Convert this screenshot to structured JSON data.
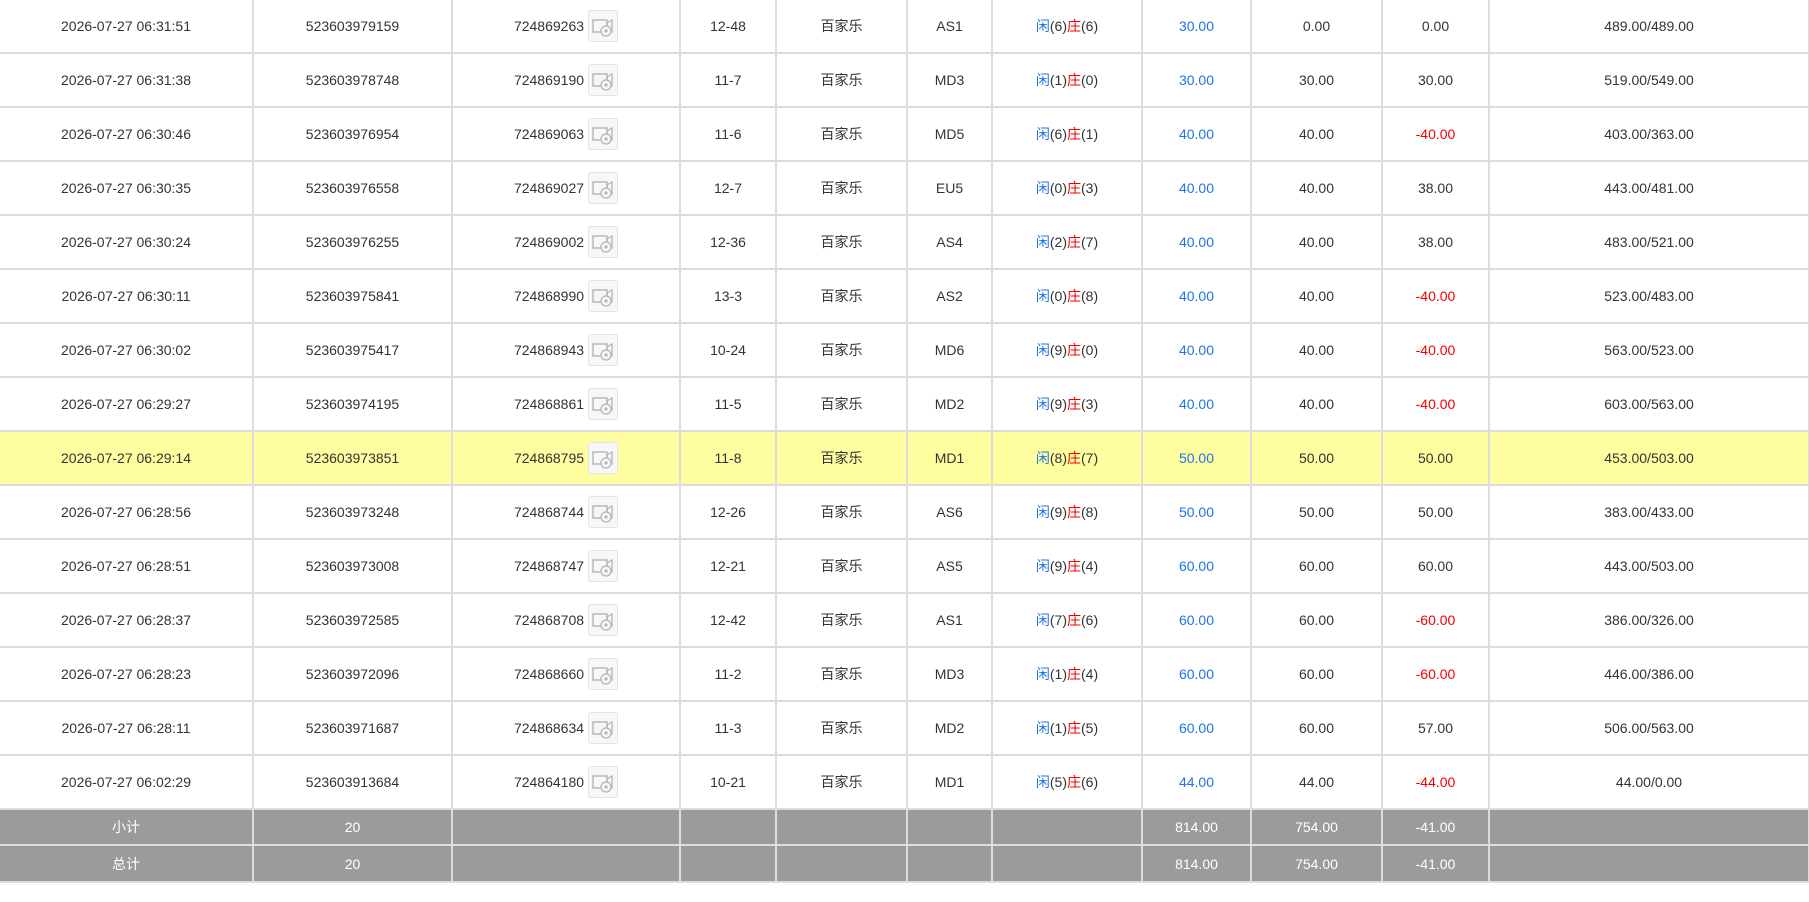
{
  "colors": {
    "player": "#1e73e8",
    "banker": "#f00000",
    "bet_amount": "#1e73e8",
    "negative": "#f00000",
    "highlight_row": "#fefea0",
    "summary_bg": "#9b9b9b"
  },
  "rows": [
    {
      "time": "2026-07-27 06:31:51",
      "order_no": "523603979159",
      "game_no": "724869263",
      "table_round": "12-48",
      "game_type": "百家乐",
      "table": "AS1",
      "player_label": "闲",
      "player_points": "(6)",
      "banker_label": "庄",
      "banker_points": "(6)",
      "bet": "30.00",
      "valid_bet": "0.00",
      "win_loss": "0.00",
      "win_loss_negative": false,
      "balance": "489.00/489.00",
      "highlight": false
    },
    {
      "time": "2026-07-27 06:31:38",
      "order_no": "523603978748",
      "game_no": "724869190",
      "table_round": "11-7",
      "game_type": "百家乐",
      "table": "MD3",
      "player_label": "闲",
      "player_points": "(1)",
      "banker_label": "庄",
      "banker_points": "(0)",
      "bet": "30.00",
      "valid_bet": "30.00",
      "win_loss": "30.00",
      "win_loss_negative": false,
      "balance": "519.00/549.00",
      "highlight": false
    },
    {
      "time": "2026-07-27 06:30:46",
      "order_no": "523603976954",
      "game_no": "724869063",
      "table_round": "11-6",
      "game_type": "百家乐",
      "table": "MD5",
      "player_label": "闲",
      "player_points": "(6)",
      "banker_label": "庄",
      "banker_points": "(1)",
      "bet": "40.00",
      "valid_bet": "40.00",
      "win_loss": "-40.00",
      "win_loss_negative": true,
      "balance": "403.00/363.00",
      "highlight": false
    },
    {
      "time": "2026-07-27 06:30:35",
      "order_no": "523603976558",
      "game_no": "724869027",
      "table_round": "12-7",
      "game_type": "百家乐",
      "table": "EU5",
      "player_label": "闲",
      "player_points": "(0)",
      "banker_label": "庄",
      "banker_points": "(3)",
      "bet": "40.00",
      "valid_bet": "40.00",
      "win_loss": "38.00",
      "win_loss_negative": false,
      "balance": "443.00/481.00",
      "highlight": false
    },
    {
      "time": "2026-07-27 06:30:24",
      "order_no": "523603976255",
      "game_no": "724869002",
      "table_round": "12-36",
      "game_type": "百家乐",
      "table": "AS4",
      "player_label": "闲",
      "player_points": "(2)",
      "banker_label": "庄",
      "banker_points": "(7)",
      "bet": "40.00",
      "valid_bet": "40.00",
      "win_loss": "38.00",
      "win_loss_negative": false,
      "balance": "483.00/521.00",
      "highlight": false
    },
    {
      "time": "2026-07-27 06:30:11",
      "order_no": "523603975841",
      "game_no": "724868990",
      "table_round": "13-3",
      "game_type": "百家乐",
      "table": "AS2",
      "player_label": "闲",
      "player_points": "(0)",
      "banker_label": "庄",
      "banker_points": "(8)",
      "bet": "40.00",
      "valid_bet": "40.00",
      "win_loss": "-40.00",
      "win_loss_negative": true,
      "balance": "523.00/483.00",
      "highlight": false
    },
    {
      "time": "2026-07-27 06:30:02",
      "order_no": "523603975417",
      "game_no": "724868943",
      "table_round": "10-24",
      "game_type": "百家乐",
      "table": "MD6",
      "player_label": "闲",
      "player_points": "(9)",
      "banker_label": "庄",
      "banker_points": "(0)",
      "bet": "40.00",
      "valid_bet": "40.00",
      "win_loss": "-40.00",
      "win_loss_negative": true,
      "balance": "563.00/523.00",
      "highlight": false
    },
    {
      "time": "2026-07-27 06:29:27",
      "order_no": "523603974195",
      "game_no": "724868861",
      "table_round": "11-5",
      "game_type": "百家乐",
      "table": "MD2",
      "player_label": "闲",
      "player_points": "(9)",
      "banker_label": "庄",
      "banker_points": "(3)",
      "bet": "40.00",
      "valid_bet": "40.00",
      "win_loss": "-40.00",
      "win_loss_negative": true,
      "balance": "603.00/563.00",
      "highlight": false
    },
    {
      "time": "2026-07-27 06:29:14",
      "order_no": "523603973851",
      "game_no": "724868795",
      "table_round": "11-8",
      "game_type": "百家乐",
      "table": "MD1",
      "player_label": "闲",
      "player_points": "(8)",
      "banker_label": "庄",
      "banker_points": "(7)",
      "bet": "50.00",
      "valid_bet": "50.00",
      "win_loss": "50.00",
      "win_loss_negative": false,
      "balance": "453.00/503.00",
      "highlight": true
    },
    {
      "time": "2026-07-27 06:28:56",
      "order_no": "523603973248",
      "game_no": "724868744",
      "table_round": "12-26",
      "game_type": "百家乐",
      "table": "AS6",
      "player_label": "闲",
      "player_points": "(9)",
      "banker_label": "庄",
      "banker_points": "(8)",
      "bet": "50.00",
      "valid_bet": "50.00",
      "win_loss": "50.00",
      "win_loss_negative": false,
      "balance": "383.00/433.00",
      "highlight": false
    },
    {
      "time": "2026-07-27 06:28:51",
      "order_no": "523603973008",
      "game_no": "724868747",
      "table_round": "12-21",
      "game_type": "百家乐",
      "table": "AS5",
      "player_label": "闲",
      "player_points": "(9)",
      "banker_label": "庄",
      "banker_points": "(4)",
      "bet": "60.00",
      "valid_bet": "60.00",
      "win_loss": "60.00",
      "win_loss_negative": false,
      "balance": "443.00/503.00",
      "highlight": false
    },
    {
      "time": "2026-07-27 06:28:37",
      "order_no": "523603972585",
      "game_no": "724868708",
      "table_round": "12-42",
      "game_type": "百家乐",
      "table": "AS1",
      "player_label": "闲",
      "player_points": "(7)",
      "banker_label": "庄",
      "banker_points": "(6)",
      "bet": "60.00",
      "valid_bet": "60.00",
      "win_loss": "-60.00",
      "win_loss_negative": true,
      "balance": "386.00/326.00",
      "highlight": false
    },
    {
      "time": "2026-07-27 06:28:23",
      "order_no": "523603972096",
      "game_no": "724868660",
      "table_round": "11-2",
      "game_type": "百家乐",
      "table": "MD3",
      "player_label": "闲",
      "player_points": "(1)",
      "banker_label": "庄",
      "banker_points": "(4)",
      "bet": "60.00",
      "valid_bet": "60.00",
      "win_loss": "-60.00",
      "win_loss_negative": true,
      "balance": "446.00/386.00",
      "highlight": false
    },
    {
      "time": "2026-07-27 06:28:11",
      "order_no": "523603971687",
      "game_no": "724868634",
      "table_round": "11-3",
      "game_type": "百家乐",
      "table": "MD2",
      "player_label": "闲",
      "player_points": "(1)",
      "banker_label": "庄",
      "banker_points": "(5)",
      "bet": "60.00",
      "valid_bet": "60.00",
      "win_loss": "57.00",
      "win_loss_negative": false,
      "balance": "506.00/563.00",
      "highlight": false
    },
    {
      "time": "2026-07-27 06:02:29",
      "order_no": "523603913684",
      "game_no": "724864180",
      "table_round": "10-21",
      "game_type": "百家乐",
      "table": "MD1",
      "player_label": "闲",
      "player_points": "(5)",
      "banker_label": "庄",
      "banker_points": "(6)",
      "bet": "44.00",
      "valid_bet": "44.00",
      "win_loss": "-44.00",
      "win_loss_negative": true,
      "balance": "44.00/0.00",
      "highlight": false
    }
  ],
  "subtotal": {
    "label": "小计",
    "count": "20",
    "bet": "814.00",
    "valid_bet": "754.00",
    "win_loss": "-41.00"
  },
  "total": {
    "label": "总计",
    "count": "20",
    "bet": "814.00",
    "valid_bet": "754.00",
    "win_loss": "-41.00"
  },
  "icons": {
    "replay": "video-replay-icon"
  }
}
